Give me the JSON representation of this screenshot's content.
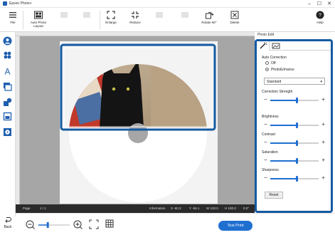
{
  "window": {
    "title": "Epson Photo+",
    "minimize": "–",
    "maximize": "☐",
    "close": "✕"
  },
  "toolbar": {
    "file": "File",
    "auto_photo_layout": "Auto Photo Layout",
    "enlarge": "Enlarge",
    "reduce": "Reduce",
    "rotate": "Rotate 90°",
    "delete": "Delete",
    "help": "Help"
  },
  "canvas": {
    "photo_subject": "black cat"
  },
  "status": {
    "page_label": "Page",
    "page_value": "1 / 1",
    "information": "Information",
    "x": "X -60.3",
    "y": "Y -56.1",
    "w": "W 120.0",
    "h": "H 100.0",
    "angle": "0.0°"
  },
  "bottom": {
    "back": "Back",
    "test_print": "Test Print"
  },
  "photo_edit": {
    "title": "Photo Edit",
    "auto_correction": "Auto Correction",
    "options": [
      {
        "label": "Off",
        "selected": false
      },
      {
        "label": "PhotoEnhance",
        "selected": true
      }
    ],
    "mode": "Standard",
    "sliders": [
      {
        "label": "Correction Strength",
        "value": 0.55
      },
      {
        "label": "Brightness",
        "value": 0.55
      },
      {
        "label": "Contrast",
        "value": 0.55
      },
      {
        "label": "Saturation",
        "value": 0.55
      },
      {
        "label": "Sharpness",
        "value": 0.55
      }
    ],
    "reset": "Reset"
  },
  "zoom": {
    "level": 0.3
  },
  "colors": {
    "accent": "#1f6fd1",
    "selection": "#155aa0",
    "workspace": "#a6a6a6"
  }
}
